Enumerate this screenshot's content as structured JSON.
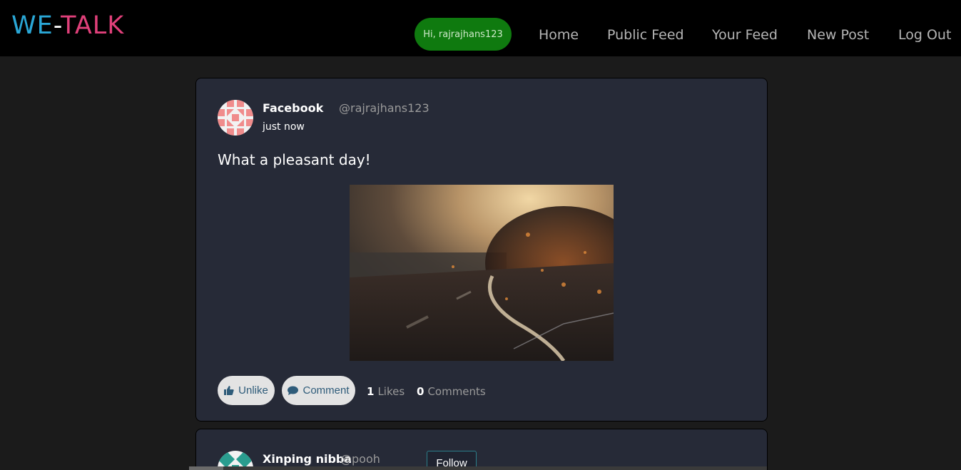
{
  "nav": {
    "logo_we": "WE",
    "logo_dash": "-",
    "logo_talk": "TALK",
    "greeting": "Hi, rajrajhans123",
    "home": "Home",
    "public_feed": "Public Feed",
    "your_feed": "Your Feed",
    "new_post": "New Post",
    "log_out": "Log Out"
  },
  "posts": [
    {
      "author_name": "Facebook",
      "author_handle": "@rajrajhans123",
      "timestamp": "just now",
      "text": "What a pleasant day!",
      "image": "blurred-sunset-road-photo",
      "unlike_label": "Unlike",
      "comment_label": "Comment",
      "likes_count": "1",
      "likes_label": "Likes",
      "comments_count": "0",
      "comments_label": "Comments"
    },
    {
      "author_name": "Xinping nibba",
      "author_handle": "@pooh",
      "follow_label": "Follow"
    }
  ],
  "colors": {
    "background": "#1b1b1b",
    "navbar": "#000000",
    "card": "#262a37",
    "greeting_pill": "#0f7a0f",
    "logo_we": "#2aa7d6",
    "logo_talk": "#e0407a"
  },
  "icons": {
    "like": "thumbs-up-icon",
    "comment": "speech-bubble-icon"
  }
}
